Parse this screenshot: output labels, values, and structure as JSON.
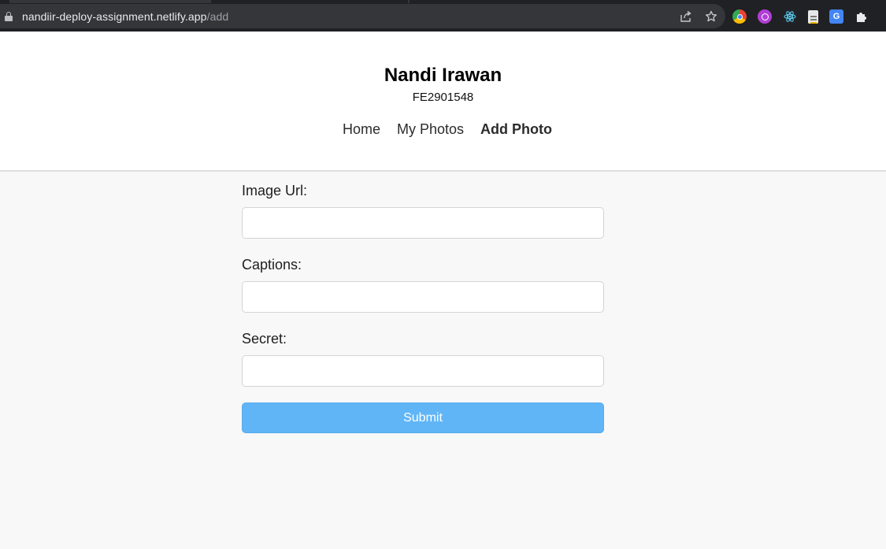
{
  "browser": {
    "url_host": "nandiir-deploy-assignment.netlify.app",
    "url_path": "/add",
    "icons": [
      "lock-icon",
      "share-icon",
      "star-icon"
    ],
    "extensions": [
      "chrome-ext-icon",
      "purple-ext-icon",
      "react-devtools-icon",
      "notes-ext-icon",
      "translate-ext-icon",
      "puzzle-icon"
    ]
  },
  "header": {
    "title": "Nandi Irawan",
    "id": "FE2901548"
  },
  "nav": {
    "items": [
      {
        "label": "Home",
        "active": false
      },
      {
        "label": "My Photos",
        "active": false
      },
      {
        "label": "Add Photo",
        "active": true
      }
    ]
  },
  "form": {
    "image_url_label": "Image Url:",
    "image_url_value": "",
    "captions_label": "Captions:",
    "captions_value": "",
    "secret_label": "Secret:",
    "secret_value": "",
    "submit_label": "Submit"
  },
  "colors": {
    "accent": "#60b5f6",
    "page_bg": "#f8f8f8",
    "header_bg": "#ffffff",
    "browser_bg": "#202124"
  }
}
